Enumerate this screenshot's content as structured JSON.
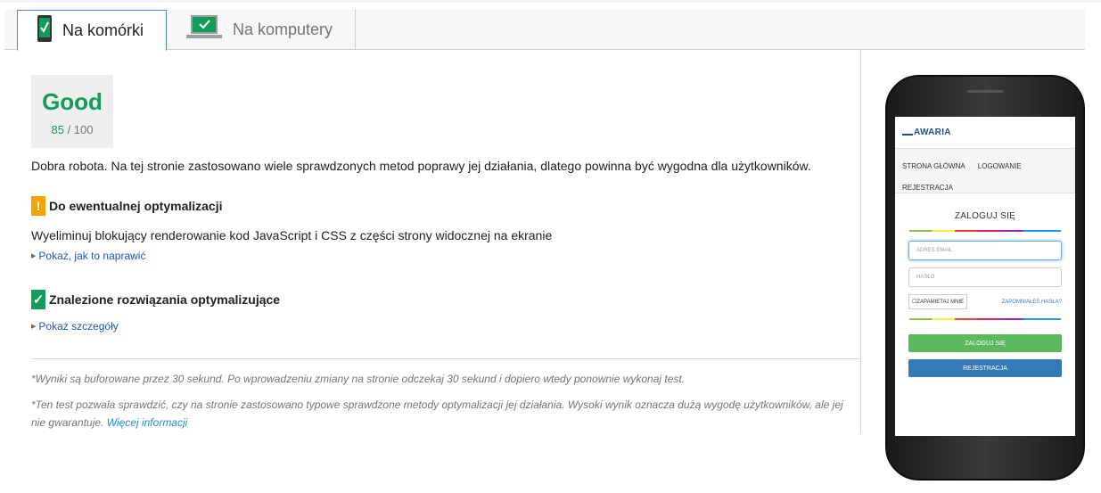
{
  "tabs": [
    {
      "label": "Na komórki",
      "icon": "mobile-phone-check-icon",
      "active": true
    },
    {
      "label": "Na komputery",
      "icon": "laptop-check-icon",
      "active": false
    }
  ],
  "score": {
    "rating": "Good",
    "value": "85",
    "max": "/ 100",
    "color": "#109d59"
  },
  "summary": "Dobra robota. Na tej stronie zastosowano wiele sprawdzonych metod poprawy jej działania, dlatego powinna być wygodna dla użytkowników.",
  "optimization": {
    "icon": "!",
    "title": "Do ewentualnej optymalizacji",
    "rule": "Wyeliminuj blokujący renderowanie kod JavaScript i CSS z części strony widocznej na ekranie",
    "link": "Pokaż, jak to naprawić"
  },
  "passed": {
    "icon": "✓",
    "title": "Znalezione rozwiązania optymalizujące",
    "link": "Pokaż szczegóły"
  },
  "notes": {
    "cache": "*Wyniki są buforowane przez 30 sekund. Po wprowadzeniu zmiany na stronie odczekaj 30 sekund i dopiero wtedy ponownie wykonaj test.",
    "disclaimer": "*Ten test pozwala sprawdzić, czy na stronie zastosowano typowe sprawdzone metody optymalizacji jej działania. Wysoki wynik oznacza dużą wygodę użytkowników, ale jej nie gwarantuje.",
    "more_link": "Więcej informacji"
  },
  "preview": {
    "logo": "AWARIA",
    "nav": [
      "STRONA GŁÓWNA",
      "LOGOWANIE",
      "REJESTRACJA"
    ],
    "title": "ZALOGUJ SIĘ",
    "email_placeholder": "ADRES EMAIL",
    "password_placeholder": "HASŁO",
    "remember": "ZAPAMIETAJ MNIE",
    "forgot": "ZAPOMNIAŁEŚ HASŁA?",
    "login_button": "ZALOGUJ SIĘ",
    "register_button": "REJESTRACJA"
  }
}
